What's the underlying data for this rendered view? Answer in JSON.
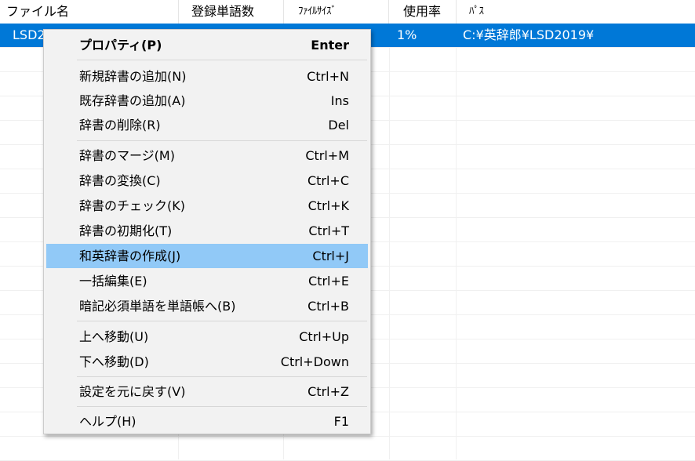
{
  "columns": [
    "ファイル名",
    "登録単語数",
    "ﾌｧｲﾙｻｲｽﾞ",
    "使用率",
    "ﾊﾟｽ"
  ],
  "rows": [
    {
      "filename": "LSD2",
      "word_count": "",
      "file_size": "",
      "usage": "1%",
      "path": "C:¥英辞郎¥LSD2019¥"
    }
  ],
  "context_menu": {
    "items": [
      {
        "label": "プロパティ(P)",
        "shortcut": "Enter"
      },
      {
        "label": "新規辞書の追加(N)",
        "shortcut": "Ctrl+N"
      },
      {
        "label": "既存辞書の追加(A)",
        "shortcut": "Ins"
      },
      {
        "label": "辞書の削除(R)",
        "shortcut": "Del"
      },
      {
        "label": "辞書のマージ(M)",
        "shortcut": "Ctrl+M"
      },
      {
        "label": "辞書の変換(C)",
        "shortcut": "Ctrl+C"
      },
      {
        "label": "辞書のチェック(K)",
        "shortcut": "Ctrl+K"
      },
      {
        "label": "辞書の初期化(T)",
        "shortcut": "Ctrl+T"
      },
      {
        "label": "和英辞書の作成(J)",
        "shortcut": "Ctrl+J"
      },
      {
        "label": "一括編集(E)",
        "shortcut": "Ctrl+E"
      },
      {
        "label": "暗記必須単語を単語帳へ(B)",
        "shortcut": "Ctrl+B"
      },
      {
        "label": "上へ移動(U)",
        "shortcut": "Ctrl+Up"
      },
      {
        "label": "下へ移動(D)",
        "shortcut": "Ctrl+Down"
      },
      {
        "label": "設定を元に戻す(V)",
        "shortcut": "Ctrl+Z"
      },
      {
        "label": "ヘルプ(H)",
        "shortcut": "F1"
      }
    ]
  },
  "colors": {
    "selection": "#0078d7",
    "menu_highlight": "#91c9f7",
    "menu_background": "#f2f2f2"
  }
}
